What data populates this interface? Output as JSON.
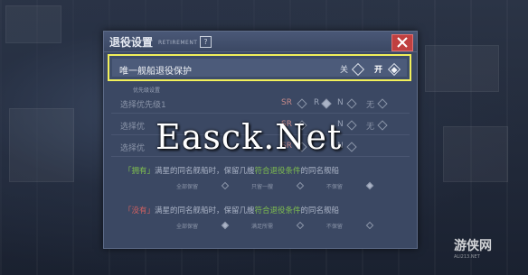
{
  "dialog": {
    "title": "退役设置",
    "subtitle": "RETIREMENT",
    "help_glyph": "?",
    "close_glyph": "×"
  },
  "protect_row": {
    "label": "唯一舰船退役保护",
    "off_label": "关",
    "on_label": "开",
    "value": "on"
  },
  "section_label": "优先级设置",
  "priority_rows": [
    {
      "label": "选择优先级1",
      "options": [
        "SR",
        "R",
        "N",
        "无"
      ],
      "selected": "R"
    },
    {
      "label": "选择优",
      "options": [
        "SR",
        "R",
        "N",
        "无"
      ],
      "selected": ""
    },
    {
      "label": "选择优",
      "options": [
        "SR",
        "R",
        "N",
        "无"
      ],
      "selected": ""
    }
  ],
  "rule_owned": {
    "tag": "「拥有」",
    "text_a": "满星的同名舰船时，保留几艘",
    "highlight": "符合退役条件",
    "text_b": "的同名舰船",
    "options": [
      "全部保留",
      "只留一艘",
      "不保留"
    ]
  },
  "rule_not_owned": {
    "tag": "「没有」",
    "text_a": "满星的同名舰船时，保留几艘",
    "highlight": "符合退役条件",
    "text_b": "的同名舰船",
    "options": [
      "全部保留",
      "满足所需",
      "不保留"
    ]
  },
  "watermark": "Easck.Net",
  "logo": {
    "main": "游侠网",
    "sub": "ALI213.NET"
  },
  "colors": {
    "highlight_border": "#f2f05a",
    "dialog_bg": "#3b4863",
    "close_bg": "#c04040"
  }
}
